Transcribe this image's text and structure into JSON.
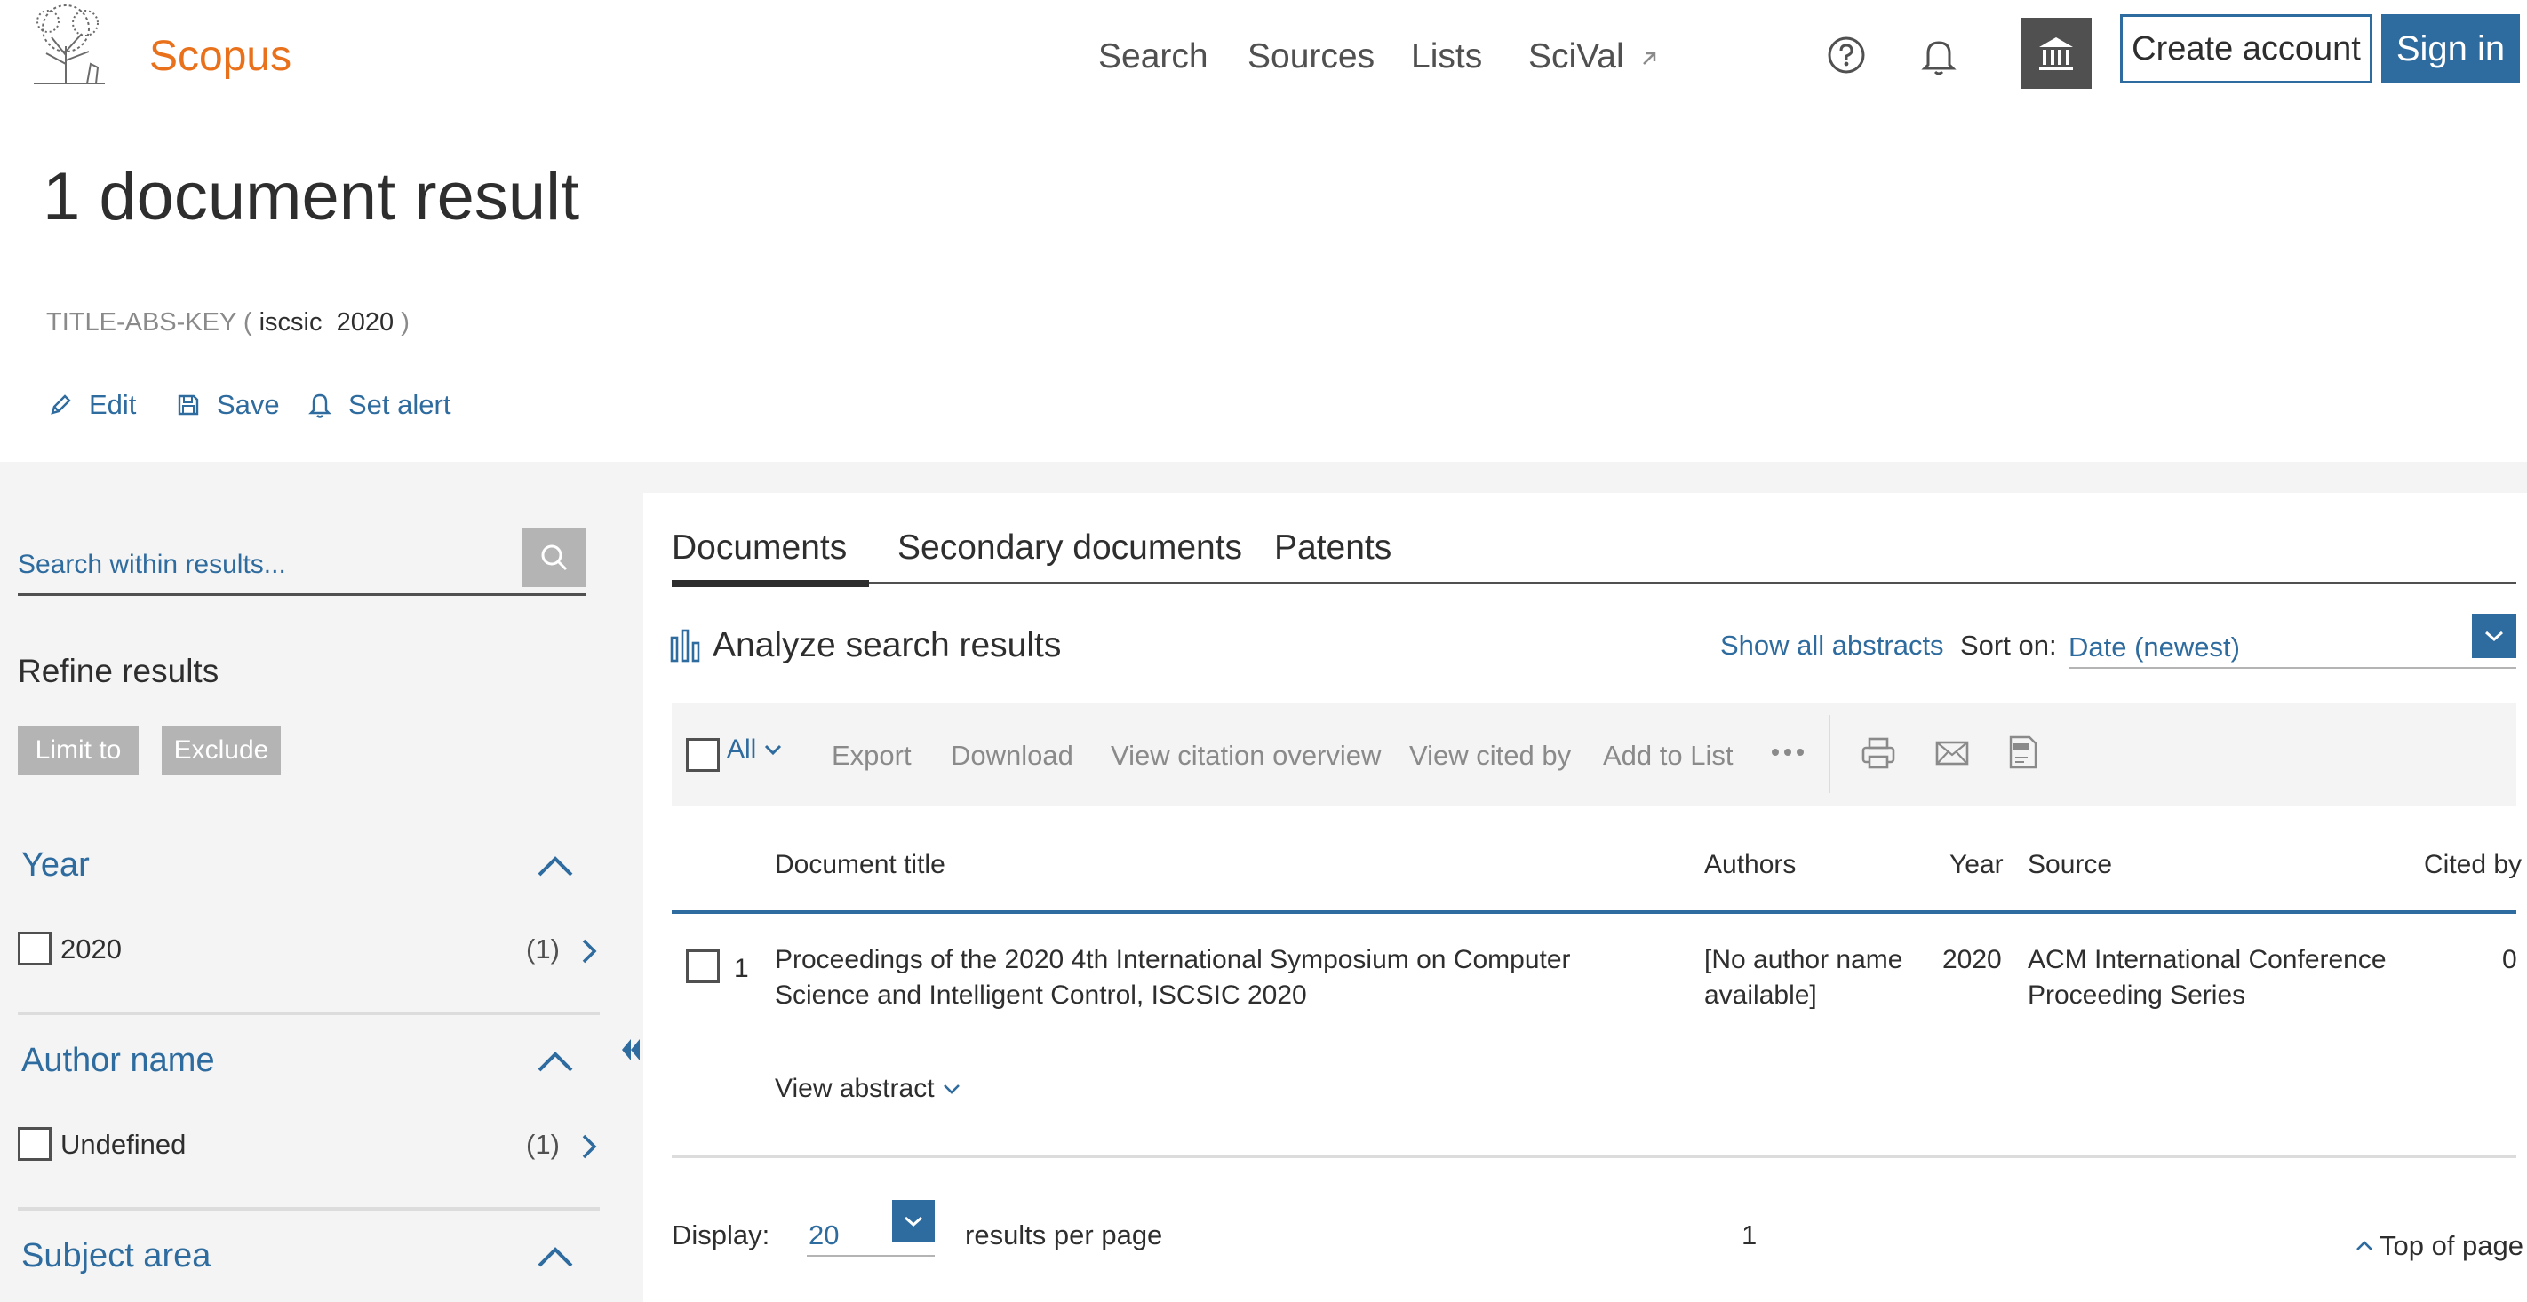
{
  "header": {
    "brand": "Scopus",
    "nav": [
      "Search",
      "Sources",
      "Lists",
      "SciVal"
    ],
    "create_account": "Create account",
    "sign_in": "Sign in"
  },
  "results": {
    "title": "1 document result",
    "query_field": "TITLE-ABS-KEY",
    "query_open": "(",
    "query_terms": "iscsic  2020",
    "query_close": ")",
    "actions": [
      "Edit",
      "Save",
      "Set alert"
    ]
  },
  "sidebar": {
    "search_placeholder": "Search within results...",
    "refine_title": "Refine results",
    "limit_to": "Limit to",
    "exclude": "Exclude",
    "facets": [
      {
        "title": "Year",
        "items": [
          {
            "label": "2020",
            "count": "(1)"
          }
        ]
      },
      {
        "title": "Author name",
        "items": [
          {
            "label": "Undefined",
            "count": "(1)"
          }
        ]
      },
      {
        "title": "Subject area",
        "items": []
      }
    ]
  },
  "main": {
    "tabs": [
      "Documents",
      "Secondary documents",
      "Patents"
    ],
    "active_tab": "Documents",
    "analyze": "Analyze search results",
    "show_all_abstracts": "Show all abstracts",
    "sort_label": "Sort on:",
    "sort_value": "Date (newest)",
    "toolbar": {
      "all": "All",
      "items": [
        "Export",
        "Download",
        "View citation overview",
        "View cited by",
        "Add to List"
      ]
    },
    "columns": [
      "Document title",
      "Authors",
      "Year",
      "Source",
      "Cited by"
    ],
    "rows": [
      {
        "index": "1",
        "title": "Proceedings of the 2020 4th International Symposium on Computer Science and Intelligent Control, ISCSIC 2020",
        "authors": "[No author name available]",
        "year": "2020",
        "source": "ACM International Conference Proceeding Series",
        "cited_by": "0",
        "view_abstract": "View abstract"
      }
    ],
    "footer": {
      "display_label": "Display:",
      "display_value": "20",
      "per_page": "results per page",
      "page": "1",
      "top_of_page": "Top of page"
    }
  },
  "colors": {
    "brand": "#e9711c",
    "link_blue": "#2e6b9e",
    "text": "#2e2e2e",
    "muted": "#8a8a8a",
    "panel_gray": "#f4f4f4"
  }
}
